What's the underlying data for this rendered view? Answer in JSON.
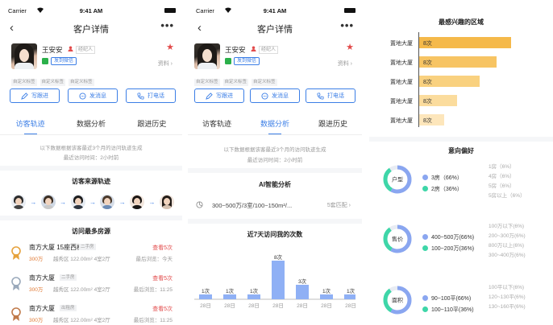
{
  "status": {
    "carrier": "Carrier",
    "time": "9:41 AM"
  },
  "nav": {
    "back": "‹",
    "title": "客户详情",
    "more": "•••"
  },
  "profile": {
    "name": "王安安",
    "manager": "经纪人",
    "wechat_tag": "发到微信",
    "info": "资料",
    "tags": [
      "自定义标签",
      "自定义标签",
      "自定义标签"
    ]
  },
  "actions": {
    "follow": "写跟进",
    "message": "发消息",
    "call": "打电话"
  },
  "tabs": [
    "访客轨迹",
    "数据分析",
    "跟进历史"
  ],
  "sub": {
    "line1": "以下数据根据该客最近3个月的访问轨迹生成",
    "line2": "最近访问时间：2小时前"
  },
  "panel1": {
    "source_title": "访客来源轨迹",
    "houses_title": "访问最多房源",
    "houses": [
      {
        "name": "南方大厦 15座西栋",
        "badge": "二手房",
        "count": "查看5次",
        "price": "300万",
        "loc": "越秀区  122.00m²  4室2厅",
        "last": "最后浏览：今天",
        "medal": "#e6a23c"
      },
      {
        "name": "南方大厦",
        "badge": "二手房",
        "count": "查看5次",
        "price": "300万",
        "loc": "越秀区  122.00m²  4室2厅",
        "last": "最后浏览：11:25",
        "medal": "#9aa9bb"
      },
      {
        "name": "南方大厦",
        "badge": "出租房",
        "count": "查看5次",
        "price": "300万",
        "loc": "越秀区  122.00m²  4室2厅",
        "last": "最后浏览：11:25",
        "medal": "#c07a4a"
      }
    ]
  },
  "panel2": {
    "ai_title": "AI智能分析",
    "ai_text": "300~500万/3室/100~150m²/...",
    "ai_match": "5套匹配",
    "visit_title": "近7天访问我的次数"
  },
  "chart_data": [
    {
      "type": "bar",
      "title": "近7天访问我的次数",
      "categories": [
        "28日",
        "28日",
        "28日",
        "28日",
        "28日",
        "28日",
        "28日"
      ],
      "values": [
        1,
        1,
        1,
        8,
        3,
        1,
        1
      ],
      "data_labels": [
        "1次",
        "1次",
        "1次",
        "8次",
        "3次",
        "1次",
        "1次"
      ],
      "ylim": [
        0,
        8
      ]
    },
    {
      "type": "bar",
      "orientation": "horizontal",
      "title": "最感兴趣的区域",
      "categories": [
        "置地大厦",
        "置地大厦",
        "置地大厦",
        "置地大厦",
        "置地大厦"
      ],
      "values": [
        8,
        8,
        8,
        8,
        8
      ],
      "data_labels": [
        "8次",
        "8次",
        "8次",
        "8次",
        "8次"
      ],
      "bar_fraction": [
        0.88,
        0.74,
        0.58,
        0.36,
        0.24
      ],
      "colors": [
        "#f5b94a",
        "#f7c463",
        "#f9d17f",
        "#fbdc9d",
        "#fde6bb"
      ]
    },
    {
      "type": "pie",
      "title": "意向偏好",
      "name": "户型",
      "slices": [
        {
          "label": "3房（66%）",
          "value": 66
        },
        {
          "label": "2房（36%）",
          "value": 36
        }
      ],
      "others": [
        "1房（6%）",
        "4房（6%）",
        "5房（6%）",
        "5房以上（6%）"
      ]
    },
    {
      "type": "pie",
      "name": "售价",
      "slices": [
        {
          "label": "400~500万(66%)",
          "value": 66
        },
        {
          "label": "100~200万(36%)",
          "value": 36
        }
      ],
      "others": [
        "100万以下(6%)",
        "200~300万(6%)",
        "800万以上(6%)",
        "300~400万(6%)"
      ]
    },
    {
      "type": "pie",
      "name": "面积",
      "slices": [
        {
          "label": "90~100平(66%)",
          "value": 66
        },
        {
          "label": "100~110平(36%)",
          "value": 36
        }
      ],
      "others": [
        "100平以下(6%)",
        "120~130平(6%)",
        "130~160平(6%)"
      ]
    }
  ],
  "colors": {
    "accent": "#3b7ee6",
    "red": "#e24b4b",
    "orange": "#e07a34",
    "bar_blue": "#8fb0f5",
    "donut_blue": "#8aa6f0",
    "donut_green": "#3ed6a8"
  }
}
